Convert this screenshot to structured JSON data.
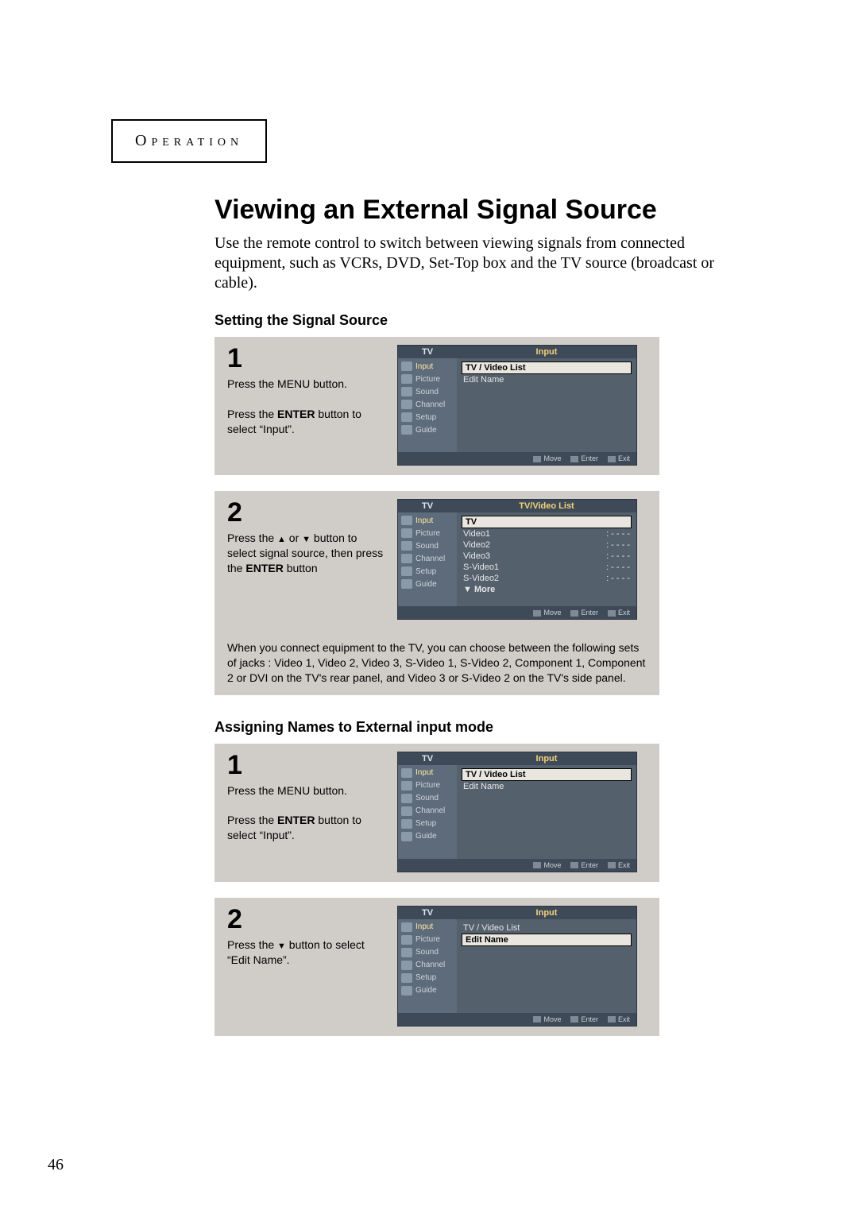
{
  "section_label": "Operation",
  "main_title": "Viewing an External Signal Source",
  "intro": "Use the remote control to switch between viewing signals from connected equipment, such as VCRs, DVD, Set-Top box and the TV source (broadcast or cable).",
  "sub1": "Setting the Signal Source",
  "sub2": "Assigning Names to External input mode",
  "steps_a": {
    "s1": {
      "num": "1",
      "l1": "Press the MENU button.",
      "l2a": "Press the ",
      "l2b": "ENTER",
      "l2c": " button to select “Input”."
    },
    "s2": {
      "num": "2",
      "p1a": "Press the ",
      "p1b": " or ",
      "p1c": " button to select signal source, then press the ",
      "p1d": "ENTER",
      "p1e": " button",
      "note": "When you connect equipment to the TV, you can choose between the following sets of jacks : Video 1, Video 2,  Video 3, S-Video 1, S-Video 2, Component 1, Component 2 or DVI on the TV's rear panel, and Video 3 or S-Video 2 on the TV's side panel."
    }
  },
  "steps_b": {
    "s1": {
      "num": "1",
      "l1": "Press the MENU button.",
      "l2a": "Press the ",
      "l2b": "ENTER",
      "l2c": " button to select “Input”."
    },
    "s2": {
      "num": "2",
      "p1a": "Press the ",
      "p1c": " button to select “Edit Name”."
    }
  },
  "osd_side": [
    "Input",
    "Picture",
    "Sound",
    "Channel",
    "Setup",
    "Guide"
  ],
  "osd_input": {
    "tv": "TV",
    "title": "Input",
    "rows": [
      "TV / Video List",
      "Edit Name"
    ]
  },
  "osd_list": {
    "tv": "TV",
    "title": "TV/Video List",
    "sel": "TV",
    "rows": [
      {
        "n": "Video1",
        "v": ": - - - -"
      },
      {
        "n": "Video2",
        "v": ": - - - -"
      },
      {
        "n": "Video3",
        "v": ": - - - -"
      },
      {
        "n": "S-Video1",
        "v": ": - - - -"
      },
      {
        "n": "S-Video2",
        "v": ": - - - -"
      }
    ],
    "more": "▼ More"
  },
  "osd_foot": {
    "move": "Move",
    "enter": "Enter",
    "exit": "Exit"
  },
  "page_number": "46"
}
